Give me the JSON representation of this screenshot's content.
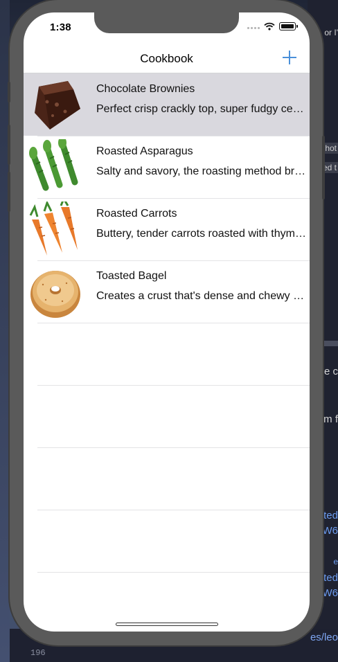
{
  "status_bar": {
    "time": "1:38"
  },
  "nav": {
    "title": "Cookbook",
    "add_label": "+"
  },
  "recipes": [
    {
      "title": "Chocolate Brownies",
      "description": "Perfect crisp crackly top, super fudgy center, and chocolate chunks.",
      "icon": "brownie-icon",
      "selected": true
    },
    {
      "title": "Roasted Asparagus",
      "description": "Salty and savory, the roasting method brings out the flavor.",
      "icon": "asparagus-icon",
      "selected": false
    },
    {
      "title": "Roasted Carrots",
      "description": "Buttery, tender carrots roasted with thyme and garlic.",
      "icon": "carrots-icon",
      "selected": false
    },
    {
      "title": "Toasted Bagel",
      "description": "Creates a crust that's dense and chewy on the outside.",
      "icon": "bagel-icon",
      "selected": false
    }
  ],
  "background": {
    "snippets": [
      "or I'",
      "hot",
      "ed t",
      "ne c",
      "m f",
      "rted",
      "W6",
      "e",
      "rted",
      "W6"
    ],
    "line_number": "196",
    "path_text": "es/leo"
  },
  "colors": {
    "accent": "#4a90d9",
    "selected_row": "#d9d8de",
    "separator": "#e3e3e5"
  }
}
